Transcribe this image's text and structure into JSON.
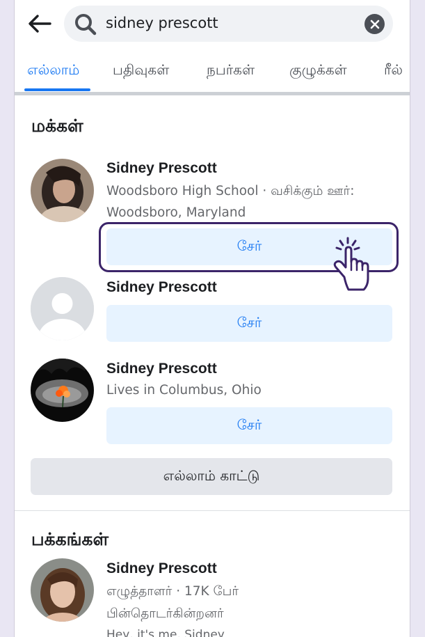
{
  "search": {
    "query": "sidney prescott"
  },
  "tabs": [
    {
      "label": "எல்லாம்",
      "active": true
    },
    {
      "label": "பதிவுகள்",
      "active": false
    },
    {
      "label": "நபர்கள்",
      "active": false
    },
    {
      "label": "குழுக்கள்",
      "active": false
    },
    {
      "label": "ரீல்",
      "active": false
    }
  ],
  "people": {
    "title": "மக்கள்",
    "results": [
      {
        "name": "Sidney Prescott",
        "line1": "Woodsboro High School · வசிக்கும் ஊர்:",
        "line2": "Woodsboro, Maryland",
        "button": "சேர்"
      },
      {
        "name": "Sidney Prescott",
        "button": "சேர்"
      },
      {
        "name": "Sidney Prescott",
        "line1": "Lives in Columbus, Ohio",
        "button": "சேர்"
      }
    ],
    "see_all": "எல்லாம் காட்டு"
  },
  "pages": {
    "title": "பக்கங்கள்",
    "results": [
      {
        "name": "Sidney Prescott",
        "line1": "எழுத்தாளர் · 17K பேர்",
        "line2": "பின்தொடர்கின்றனர்",
        "line3": "Hey, it's me, Sidney"
      }
    ]
  },
  "colors": {
    "accent": "#1877f2",
    "highlight_border": "#3b2469",
    "button_bg": "#e7f3ff"
  }
}
